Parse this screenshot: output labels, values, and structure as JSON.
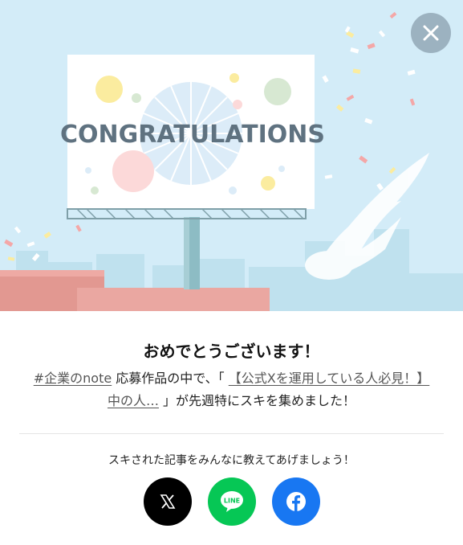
{
  "banner": {
    "billboard_text": "CONGRATULATIONS",
    "colors": {
      "sky": "#d3ecf8",
      "rooftop": "#e8a19c",
      "billboard": "#ffffff",
      "text": "#5f7280"
    }
  },
  "close_button": {
    "icon": "close-icon"
  },
  "dialog": {
    "title": "おめでとうございます！",
    "hashtag_link": "#企業のnote",
    "text_1": " 応募作品の中で、「 ",
    "article_link": "【公式Xを運用している人必見！】中の人…",
    "text_2": " 」が先週特にスキを集めました！"
  },
  "share": {
    "prompt": "スキされた記事をみんなに教えてあげましょう！",
    "buttons": [
      {
        "name": "X",
        "icon": "x-logo-icon",
        "color": "#000000"
      },
      {
        "name": "LINE",
        "icon": "line-logo-icon",
        "color": "#06c755",
        "label": "LINE"
      },
      {
        "name": "Facebook",
        "icon": "facebook-logo-icon",
        "color": "#1877f2"
      }
    ]
  }
}
